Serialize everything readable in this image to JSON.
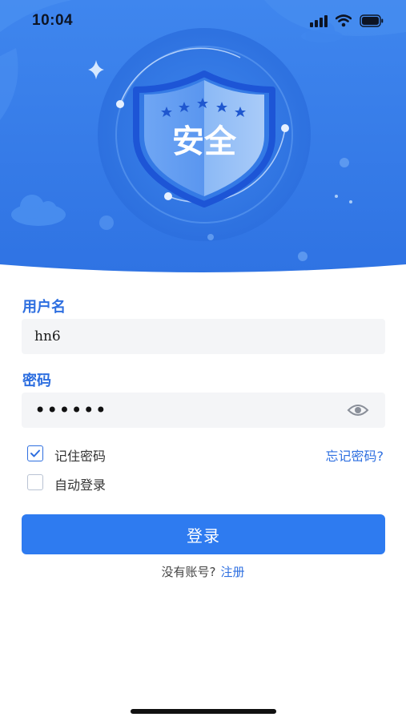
{
  "status_bar": {
    "time": "10:04"
  },
  "hero": {
    "badge_text": "安全"
  },
  "form": {
    "username_label": "用户名",
    "username_value": "hn6",
    "password_label": "密码",
    "password_masked": "••••••",
    "remember_label": "记住密码",
    "remember_checked": true,
    "auto_login_label": "自动登录",
    "auto_login_checked": false,
    "forgot_label": "忘记密码?",
    "login_button": "登录",
    "no_account_text": "没有账号?",
    "register_link": "注册"
  },
  "colors": {
    "accent": "#2e7bf0",
    "label_blue": "#2e6fe0",
    "hero_dark": "#2a6bde",
    "hero_light": "#5b9ff5"
  },
  "icons": [
    "signal-icon",
    "wifi-icon",
    "battery-icon",
    "eye-icon",
    "check-icon",
    "shield-icon",
    "cloud-icon",
    "sparkle-icon"
  ]
}
